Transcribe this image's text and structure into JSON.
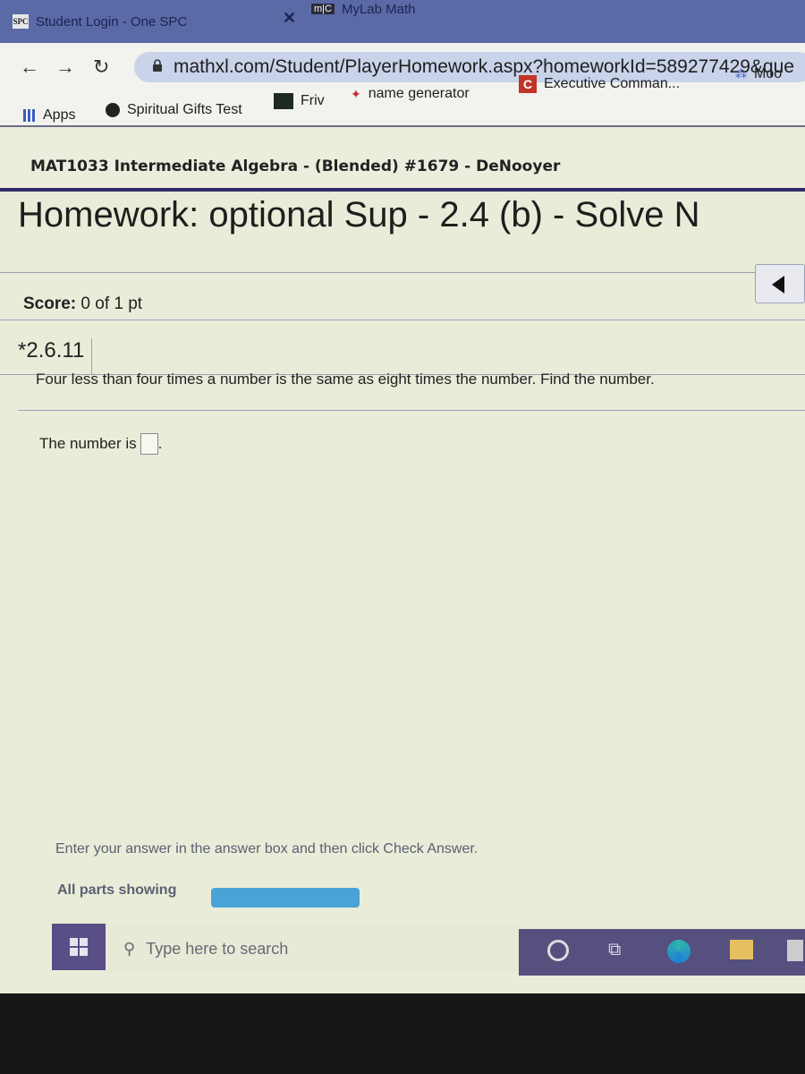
{
  "browser": {
    "tabs": [
      {
        "favicon": "SPC",
        "title": "Student Login - One SPC",
        "active": true
      },
      {
        "favicon": "m|C",
        "title": "MyLab Math"
      }
    ],
    "url": "mathxl.com/Student/PlayerHomework.aspx?homeworkId=589277429&que",
    "bookmarks": [
      {
        "icon": "apps-grid-icon",
        "label": "Apps"
      },
      {
        "icon": "spiritual-gifts-icon",
        "label": "Spiritual Gifts Test"
      },
      {
        "icon": "friv-icon",
        "label": "Friv"
      },
      {
        "icon": "name-generator-icon",
        "label": "name generator"
      },
      {
        "icon": "executive-command-icon",
        "label": "Executive Comman..."
      },
      {
        "icon": "moo-icon",
        "label": "Moo"
      }
    ]
  },
  "page": {
    "course_title": "MAT1033 Intermediate Algebra - (Blended) #1679 - DeNooyer",
    "homework_title": "Homework: optional Sup - 2.4 (b) - Solve N",
    "score_label": "Score:",
    "score_value": "0 of 1 pt",
    "question_number": "*2.6.11",
    "question_text": "Four less than four times a number is the same as eight times the number. Find the number.",
    "answer_prefix": "The number is",
    "answer_value": "",
    "answer_suffix": ".",
    "instructions": "Enter your answer in the answer box and then click Check Answer.",
    "parts_label": "All parts showing",
    "check_button_color": "#4aa3d6"
  },
  "taskbar": {
    "search_placeholder": "Type here to search",
    "accent": "#5a4e86"
  }
}
